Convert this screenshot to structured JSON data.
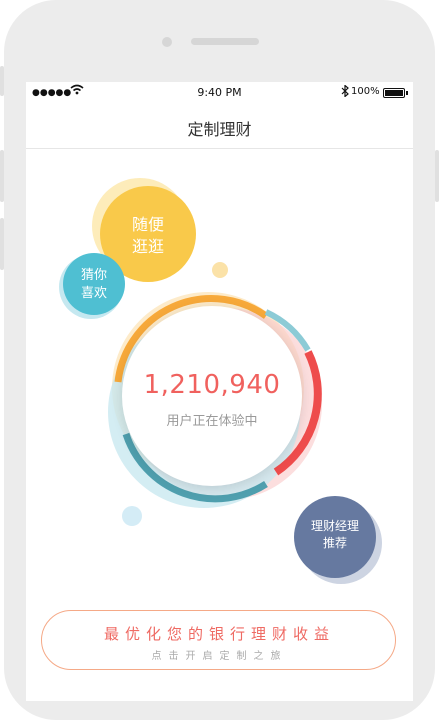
{
  "statusbar": {
    "time": "9:40 PM",
    "battery": "100%",
    "signal": "●●●●●",
    "wifi": "wifi-icon",
    "bluetooth": "bluetooth-icon"
  },
  "navbar": {
    "title": "定制理财"
  },
  "bubbles": {
    "browse": {
      "line1": "随便",
      "line2": "逛逛"
    },
    "guess": {
      "line1": "猜你",
      "line2": "喜欢"
    },
    "manager": {
      "line1": "理财经理",
      "line2": "推荐"
    }
  },
  "stats": {
    "count": "1,210,940",
    "label": "用户正在体验中"
  },
  "cta": {
    "title": "最优化您的银行理财收益",
    "subtitle": "点击开启定制之旅"
  },
  "colors": {
    "yellow": "#f9c94a",
    "teal": "#4fbfd2",
    "navy": "#6679a0",
    "orange": "#f7a93a",
    "red": "#ee4c4c",
    "accent": "#ef6a63"
  }
}
